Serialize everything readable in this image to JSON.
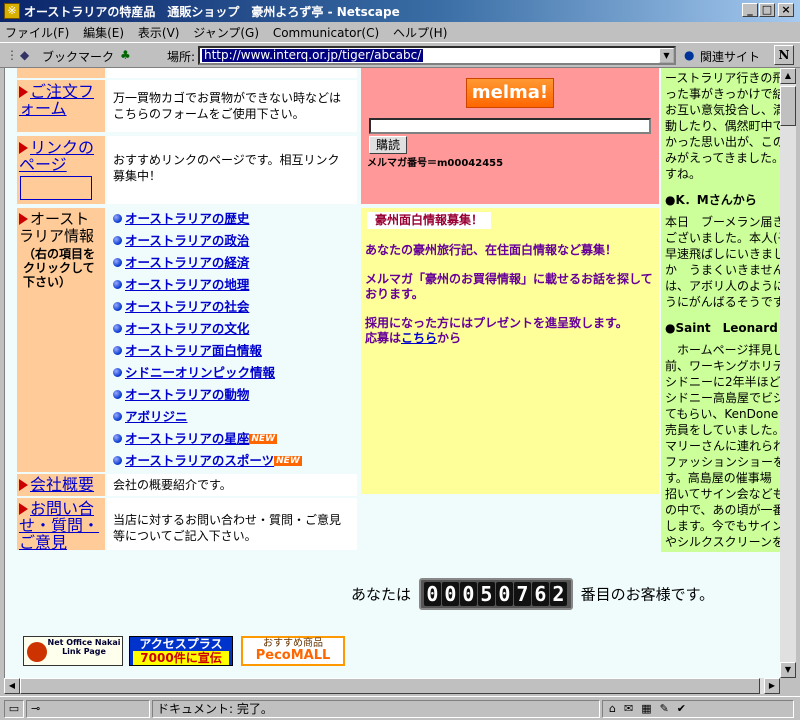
{
  "window": {
    "title": "オーストラリアの特産品　通販ショップ　豪州よろず亭 - Netscape"
  },
  "menu": [
    "ファイル(F)",
    "編集(E)",
    "表示(V)",
    "ジャンプ(G)",
    "Communicator(C)",
    "ヘルプ(H)"
  ],
  "toolbar": {
    "bookmarks_label": "ブックマーク",
    "location_label": "場所:",
    "url": "http://www.interq.or.jp/tiger/abcabc/",
    "related_label": "関連サイト"
  },
  "nav": {
    "order_form": {
      "label": "ご注文フォーム",
      "desc": "万一買物カゴでお買物ができない時などはこちらのフォームをご使用下さい。"
    },
    "links": {
      "label": "リンクのページ",
      "desc": "おすすめリンクのページです。相互リンク募集中！"
    },
    "australia_info": {
      "label": "オーストラリア情報",
      "note": "（右の項目をクリックして下さい）",
      "items": [
        {
          "label": "オーストラリアの歴史",
          "new": ""
        },
        {
          "label": "オーストラリアの政治",
          "new": ""
        },
        {
          "label": "オーストラリアの経済",
          "new": ""
        },
        {
          "label": "オーストラリアの地理",
          "new": ""
        },
        {
          "label": "オーストラリアの社会",
          "new": ""
        },
        {
          "label": "オーストラリアの文化",
          "new": ""
        },
        {
          "label": "オーストラリア面白情報",
          "new": ""
        },
        {
          "label": "シドニーオリンピック情報",
          "new": ""
        },
        {
          "label": "オーストラリアの動物",
          "new": ""
        },
        {
          "label": "アボリジニ",
          "new": ""
        },
        {
          "label": "オーストラリアの星座",
          "new": "NEW"
        },
        {
          "label": "オーストラリアのスポーツ",
          "new": "NEW"
        }
      ]
    },
    "company": {
      "label": "会社概要",
      "desc": "会社の概要紹介です。"
    },
    "contact": {
      "label": "お問い合せ・質問・ご意見",
      "desc": "当店に対するお問い合わせ・質問・ご意見等についてご記入下さい。"
    }
  },
  "melma": {
    "logo": "melma!",
    "button": "購読",
    "number": "メルマガ番号＝m00042455"
  },
  "recruit": {
    "heading": "豪州面白情報募集！",
    "line1": "あなたの豪州旅行記、在住面白情報など募集！",
    "line2": "メルマガ「豪州のお買得情報」に載せるお話を探しております。",
    "line3": "採用になった方にはプレゼントを進呈致します。",
    "apply_prefix": "応募は",
    "apply_link": "こちら",
    "apply_suffix": "から"
  },
  "testimonials": {
    "lines_top": [
      "ーストラリア行きの飛",
      "った事がきっかけで結",
      "お互い意気投合し、満",
      "動したり、偶然町中で",
      "かった思い出が、この",
      "みがえってきました。",
      "すね。"
    ],
    "person1": "●K．Mさんから",
    "lines_mid": [
      "本日　ブーメラン届き",
      "ございました。本人(子",
      "早速飛ばしにいきまし",
      "か　うまくいきません",
      "は、アボリ人のように",
      "うにがんばるそうです"
    ],
    "person2": "●Saint　Leonard",
    "lines_bot": [
      "　ホームページ拝見し",
      "前、ワーキングホリデ",
      "シドニーに2年半ほど",
      "シドニー高島屋でビジ",
      "てもらい、KenDoneコ",
      "売員をしていました。",
      "マリーさんに連れられ",
      "ファッションショーを見",
      "す。高島屋の催事場",
      "招いてサイン会なども",
      "の中で、あの頃が一番",
      "します。今でもサイン",
      "やシルクスクリーンを"
    ]
  },
  "counter": {
    "prefix": "あなたは",
    "digits": "00050762",
    "suffix": "番目のお客様です。"
  },
  "banners": {
    "netoffice": "Net Office Nakai Link Page",
    "access_line1": "アクセスプラス",
    "access_line2": "7000件に宣伝",
    "pecomall_line1": "おすすめ商品",
    "pecomall_line2": "PecoMALL"
  },
  "status": {
    "text": "ドキュメント: 完了。"
  },
  "colors": {
    "nav_bg": "#ffcc99",
    "melma_bg": "#ff9999",
    "recruit_bg": "#ffff99",
    "right_bg": "#ccff99",
    "link": "#0000cc"
  }
}
